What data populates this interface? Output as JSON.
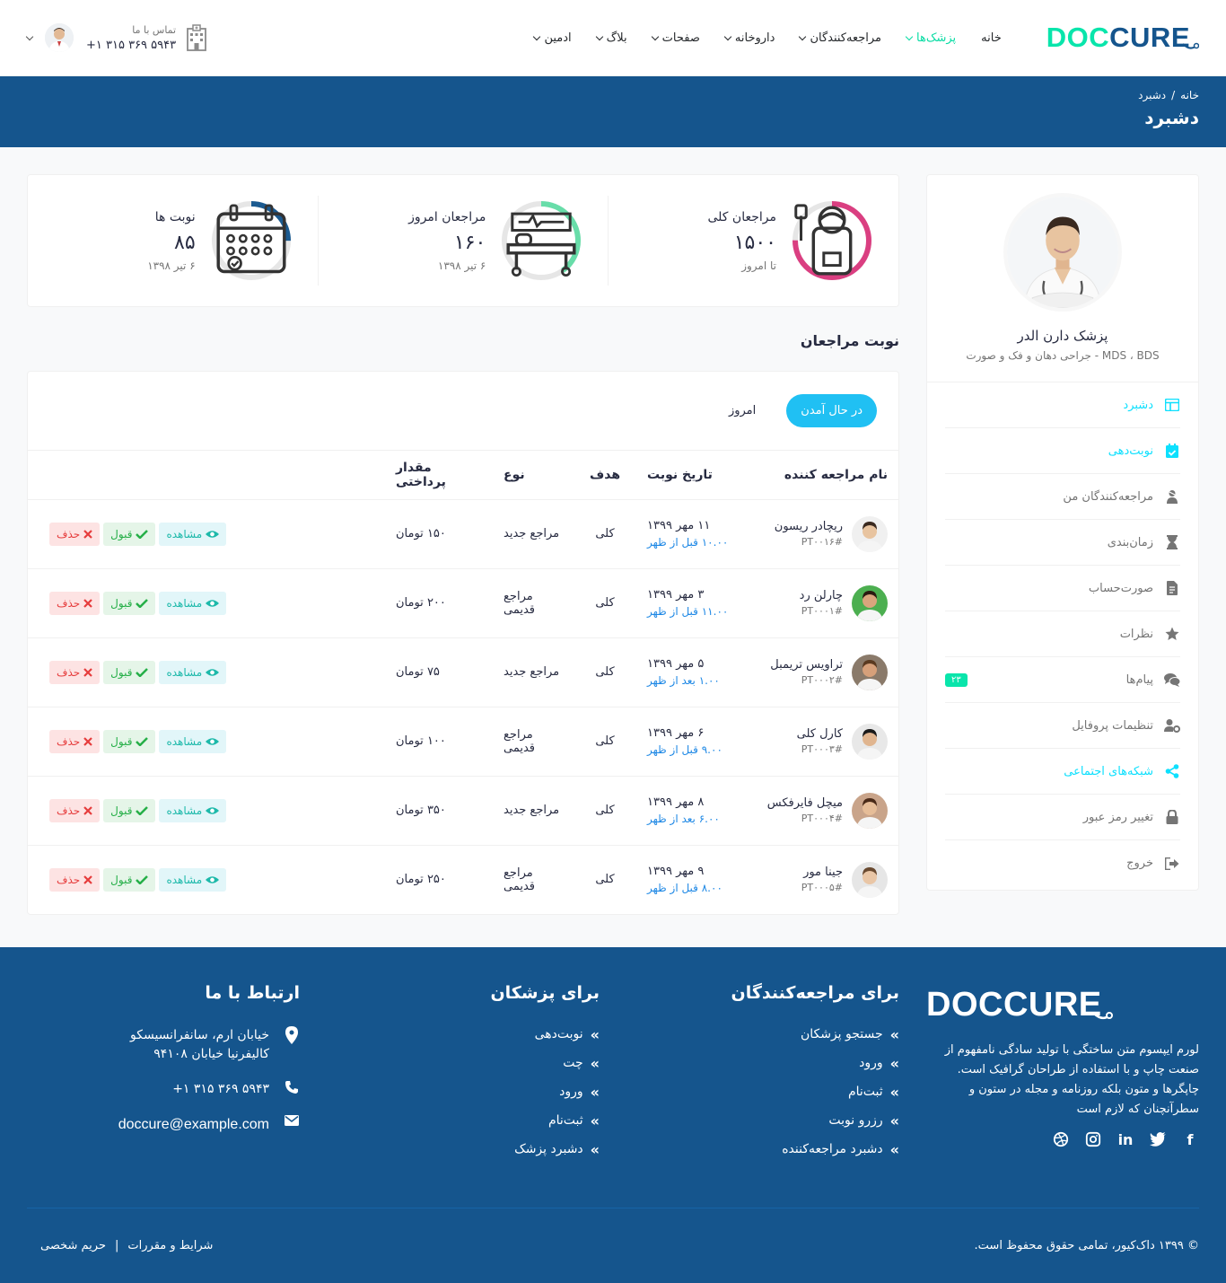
{
  "header": {
    "logo": {
      "a": "DOC",
      "b": "CURE"
    },
    "nav": [
      {
        "label": "خانه",
        "dropdown": false,
        "active": false
      },
      {
        "label": "پزشک‌ها",
        "dropdown": true,
        "active": true
      },
      {
        "label": "مراجعه‌کنندگان",
        "dropdown": true,
        "active": false
      },
      {
        "label": "داروخانه",
        "dropdown": true,
        "active": false
      },
      {
        "label": "صفحات",
        "dropdown": true,
        "active": false
      },
      {
        "label": "بلاگ",
        "dropdown": true,
        "active": false
      },
      {
        "label": "ادمین",
        "dropdown": true,
        "active": false
      }
    ],
    "contact_label": "تماس با ما",
    "contact_phone": "+۱ ۳۱۵ ۳۶۹ ۵۹۴۳"
  },
  "breadcrumb": {
    "home": "خانه",
    "sep": "/",
    "current": "دشبرد",
    "title": "دشبرد"
  },
  "profile": {
    "name": "پزشک دارن الدر",
    "specialty": "MDS ، BDS - جراحی دهان و فک و صورت"
  },
  "menu": [
    {
      "label": "دشبرد",
      "icon": "dashboard-icon",
      "active": true
    },
    {
      "label": "نوبت‌دهی",
      "icon": "calendar-check-icon",
      "active": true
    },
    {
      "label": "مراجعه‌کنندگان من",
      "icon": "user-injured-icon",
      "active": false
    },
    {
      "label": "زمان‌بندی",
      "icon": "hourglass-icon",
      "active": false
    },
    {
      "label": "صورت‌حساب",
      "icon": "file-invoice-icon",
      "active": false
    },
    {
      "label": "نظرات",
      "icon": "star-icon",
      "active": false
    },
    {
      "label": "پیام‌ها",
      "icon": "comments-icon",
      "active": false,
      "badge": "۲۳"
    },
    {
      "label": "تنظیمات پروفایل",
      "icon": "user-cog-icon",
      "active": false
    },
    {
      "label": "شبکه‌های اجتماعی",
      "icon": "share-icon",
      "active": true
    },
    {
      "label": "تغییر رمز عبور",
      "icon": "lock-icon",
      "active": false
    },
    {
      "label": "خروج",
      "icon": "sign-out-icon",
      "active": false
    }
  ],
  "stats": [
    {
      "title": "مراجعان کلی",
      "value": "۱۵۰۰",
      "sub": "تا امروز",
      "color": "#da3f81",
      "percent": 75
    },
    {
      "title": "مراجعان امروز",
      "value": "۱۶۰",
      "sub": "۶ تیر ۱۳۹۸",
      "color": "#68dda9",
      "percent": 40
    },
    {
      "title": "نوبت ها",
      "value": "۸۵",
      "sub": "۶ تیر ۱۳۹۸",
      "color": "#1b5a90",
      "percent": 25
    }
  ],
  "section_title": "نوبت مراجعان",
  "tabs": {
    "upcoming": "در حال آمدن",
    "today": "امروز"
  },
  "table": {
    "headers": {
      "name": "نام مراجعه کننده",
      "date": "تاریخ نوبت",
      "purpose": "هدف",
      "type": "نوع",
      "amount": "مقدار پرداختی"
    },
    "buttons": {
      "view": "مشاهده",
      "accept": "قبول",
      "delete": "حذف"
    },
    "rows": [
      {
        "name": "ریچادر ریسون",
        "id": "#PT۰۰۱۶",
        "date": "۱۱ مهر ۱۳۹۹",
        "time": "۱۰.۰۰ قبل از ظهر",
        "purpose": "کلی",
        "type": "مراجع جدید",
        "amount": "۱۵۰ تومان",
        "hair": "#3a2a20",
        "skin": "#e8c4a0",
        "bg": "#f0f0f0"
      },
      {
        "name": "چارلن رد",
        "id": "#PT۰۰۰۱",
        "date": "۳ مهر ۱۳۹۹",
        "time": "۱۱.۰۰ قبل از ظهر",
        "purpose": "کلی",
        "type": "مراجع قدیمی",
        "amount": "۲۰۰ تومان",
        "hair": "#2a1a10",
        "skin": "#d9a57d",
        "bg": "#4caf50"
      },
      {
        "name": "تراویس تریمبل",
        "id": "#PT۰۰۰۲",
        "date": "۵ مهر ۱۳۹۹",
        "time": "۱.۰۰ بعد از ظهر",
        "purpose": "کلی",
        "type": "مراجع جدید",
        "amount": "۷۵ تومان",
        "hair": "#5a3a20",
        "skin": "#d6a07a",
        "bg": "#8a7a6a"
      },
      {
        "name": "کارل کلی",
        "id": "#PT۰۰۰۳",
        "date": "۶ مهر ۱۳۹۹",
        "time": "۹.۰۰ قبل از ظهر",
        "purpose": "کلی",
        "type": "مراجع قدیمی",
        "amount": "۱۰۰ تومان",
        "hair": "#1a1a1a",
        "skin": "#e0b58f",
        "bg": "#e8e8e8"
      },
      {
        "name": "میچل فایرفکس",
        "id": "#PT۰۰۰۴",
        "date": "۸ مهر ۱۳۹۹",
        "time": "۶.۰۰ بعد از ظهر",
        "purpose": "کلی",
        "type": "مراجع جدید",
        "amount": "۳۵۰ تومان",
        "hair": "#4a2a18",
        "skin": "#e6bd98",
        "bg": "#c9a48a"
      },
      {
        "name": "جینا مور",
        "id": "#PT۰۰۰۵",
        "date": "۹ مهر ۱۳۹۹",
        "time": "۸.۰۰ قبل از ظهر",
        "purpose": "کلی",
        "type": "مراجع قدیمی",
        "amount": "۲۵۰ تومان",
        "hair": "#6a4a30",
        "skin": "#e9c6a6",
        "bg": "#e6e6e6"
      }
    ]
  },
  "footer": {
    "about": "لورم ایپسوم متن ساختگی با تولید سادگی نامفهوم از صنعت چاپ و با استفاده از طراحان گرافیک است. چاپگرها و متون بلکه روزنامه و مجله در ستون و سطرآنچنان که لازم است",
    "patients_title": "برای مراجعه‌کنندگان",
    "patients_links": [
      "جستجو پزشکان",
      "ورود",
      "ثبت‌نام",
      "رزرو نوبت",
      "دشبرد مراجعه‌کننده"
    ],
    "doctors_title": "برای پزشکان",
    "doctors_links": [
      "نوبت‌دهی",
      "چت",
      "ورود",
      "ثبت‌نام",
      "دشبرد پزشک"
    ],
    "contact_title": "ارتباط با ما",
    "address_1": "خیابان ارم، سانفرانسیسکو",
    "address_2": "کالیفرنیا خیابان ۹۴۱۰۸",
    "phone": "+۱ ۳۱۵ ۳۶۹ ۵۹۴۳",
    "email": "doccure@example.com",
    "copyright": "© ۱۳۹۹ داک‌کیور، تمامی حقوق محفوظ است.",
    "terms": "شرایط و مقررات",
    "sep": "|",
    "privacy": "حریم شخصی"
  }
}
